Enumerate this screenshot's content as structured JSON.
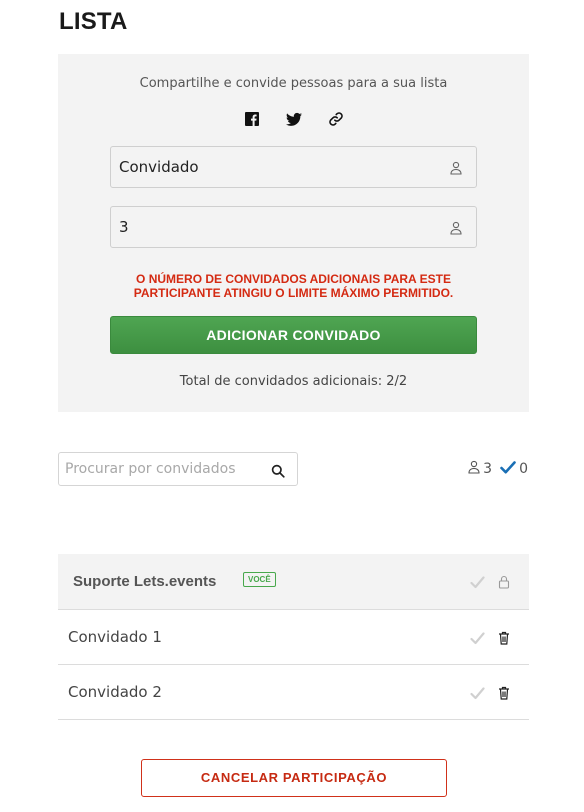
{
  "page": {
    "title": "LISTA"
  },
  "share": {
    "text": "Compartilhe e convide pessoas para a sua lista",
    "icons": [
      "facebook-icon",
      "twitter-icon",
      "link-icon"
    ]
  },
  "form": {
    "name_value": "Convidado",
    "count_value": "3",
    "error_message": "O NÚMERO DE CONVIDADOS ADICIONAIS PARA ESTE PARTICIPANTE ATINGIU O LIMITE MÁXIMO PERMITIDO.",
    "add_button_label": "ADICIONAR CONVIDADO",
    "total_text": "Total de convidados adicionais: 2/2"
  },
  "search": {
    "placeholder": "Procurar por convidados",
    "value": ""
  },
  "counters": {
    "guests": "3",
    "checked_in": "0"
  },
  "guests": {
    "owner": {
      "name": "Suporte Lets.events",
      "badge": "VOCÊ"
    },
    "items": [
      {
        "name": "Convidado 1"
      },
      {
        "name": "Convidado 2"
      }
    ]
  },
  "cancel_button_label": "CANCELAR PARTICIPAÇÃO",
  "colors": {
    "accent_green": "#43994a",
    "error_red": "#d42a12",
    "check_blue": "#1a6fb5",
    "panel_bg": "#f3f3f3"
  }
}
